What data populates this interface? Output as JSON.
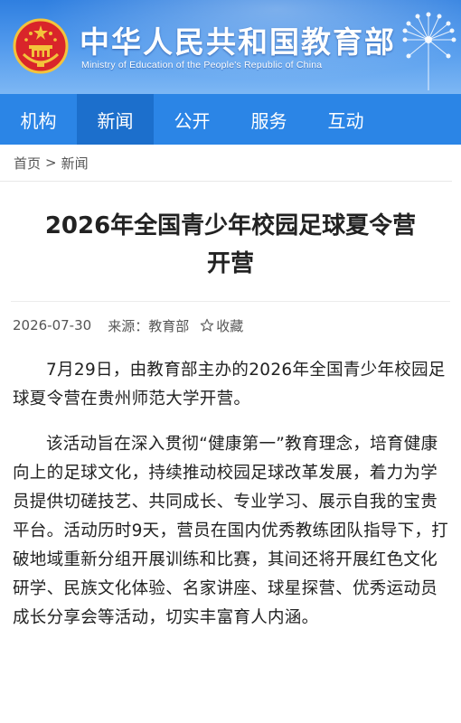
{
  "header": {
    "title": "中华人民共和国教育部",
    "subtitle": "Ministry of Education of the People's Republic of China",
    "emblem_icon": "national-emblem-icon",
    "colors": {
      "banner_top": "#2f7fe0",
      "banner_bottom": "#7db7f4",
      "nav": "#2b85e6",
      "nav_active": "#1c6fcc"
    }
  },
  "nav": {
    "items": [
      {
        "label": "机构"
      },
      {
        "label": "新闻",
        "active": true
      },
      {
        "label": "公开"
      },
      {
        "label": "服务"
      },
      {
        "label": "互动"
      }
    ]
  },
  "breadcrumb": {
    "home": "首页",
    "separator": ">",
    "current": "新闻"
  },
  "article": {
    "title": "2026年全国青少年校园足球夏令营开营",
    "date": "2026-07-30",
    "source": "来源：教育部",
    "favorite_label": "收藏",
    "favorite_icon": "star-outline-icon",
    "paragraphs": [
      "7月29日，由教育部主办的2026年全国青少年校园足球夏令营在贵州师范大学开营。",
      "该活动旨在深入贯彻“健康第一”教育理念，培育健康向上的足球文化，持续推动校园足球改革发展，着力为学员提供切磋技艺、共同成长、专业学习、展示自我的宝贵平台。活动历时9天，营员在国内优秀教练团队指导下，打破地域重新分组开展训练和比赛，其间还将开展红色文化研学、民族文化体验、名家讲座、球星探营、优秀运动员成长分享会等活动，切实丰富育人内涵。"
    ]
  }
}
